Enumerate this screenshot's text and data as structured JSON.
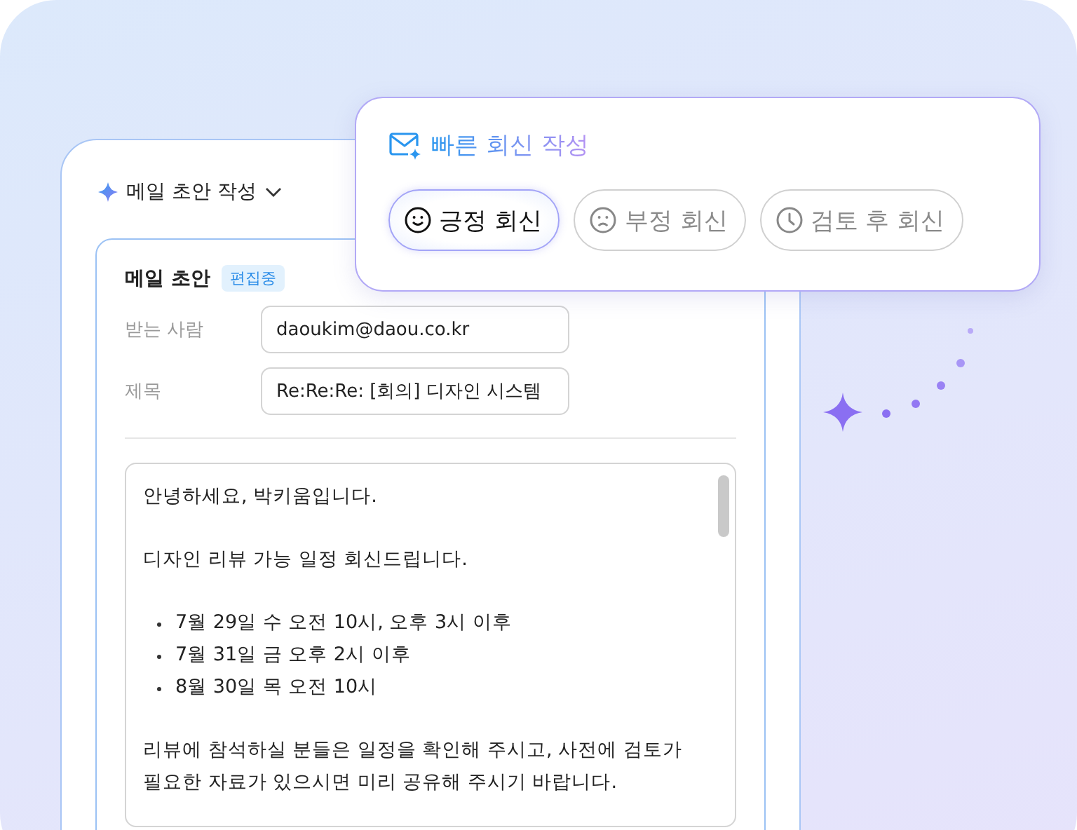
{
  "panel": {
    "title": "메일 초안 작성"
  },
  "draft": {
    "title": "메일 초안",
    "badge": "편집중",
    "fields": [
      {
        "label": "받는 사람",
        "value": "daoukim@daou.co.kr"
      },
      {
        "label": "제목",
        "value": "Re:Re:Re: [회의] 디자인 시스템"
      }
    ],
    "body": [
      {
        "kind": "paragraph",
        "text": "안녕하세요, 박키움입니다."
      },
      {
        "kind": "paragraph",
        "text": "디자인 리뷰 가능 일정 회신드립니다."
      },
      {
        "kind": "bullets",
        "items": [
          "7월 29일 수 오전 10시, 오후 3시 이후",
          "7월 31일 금 오후 2시 이후",
          "8월 30일 목 오전 10시"
        ]
      },
      {
        "kind": "paragraph",
        "text": "리뷰에 참석하실 분들은 일정을 확인해 주시고, 사전에 검토가 필요한 자료가 있으시면 미리 공유해 주시기 바랍니다."
      }
    ]
  },
  "quick_reply": {
    "title": "빠른 회신 작성",
    "options": [
      {
        "kind": "positive",
        "label": "긍정 회신",
        "selected": true
      },
      {
        "kind": "negative",
        "label": "부정 회신",
        "selected": false
      },
      {
        "kind": "review",
        "label": "검토 후 회신",
        "selected": false
      }
    ]
  }
}
